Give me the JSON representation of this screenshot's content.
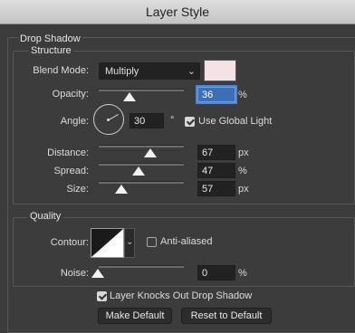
{
  "window": {
    "title": "Layer Style"
  },
  "drop_shadow": {
    "title": "Drop Shadow",
    "structure": {
      "title": "Structure",
      "blend_mode": {
        "label": "Blend Mode:",
        "value": "Multiply",
        "color": "#f3e3e5"
      },
      "opacity": {
        "label": "Opacity:",
        "value": "36",
        "unit": "%"
      },
      "angle": {
        "label": "Angle:",
        "value": "30",
        "unit": "°",
        "use_global_light": {
          "label": "Use Global Light",
          "checked": true
        }
      },
      "distance": {
        "label": "Distance:",
        "value": "67",
        "unit": "px"
      },
      "spread": {
        "label": "Spread:",
        "value": "47",
        "unit": "%"
      },
      "size": {
        "label": "Size:",
        "value": "57",
        "unit": "px"
      }
    },
    "quality": {
      "title": "Quality",
      "contour": {
        "label": "Contour:",
        "anti_aliased": {
          "label": "Anti-aliased",
          "checked": false
        }
      },
      "noise": {
        "label": "Noise:",
        "value": "0",
        "unit": "%"
      }
    },
    "knockout": {
      "label": "Layer Knocks Out Drop Shadow",
      "checked": true
    },
    "buttons": {
      "make_default": "Make Default",
      "reset_default": "Reset to Default"
    }
  }
}
